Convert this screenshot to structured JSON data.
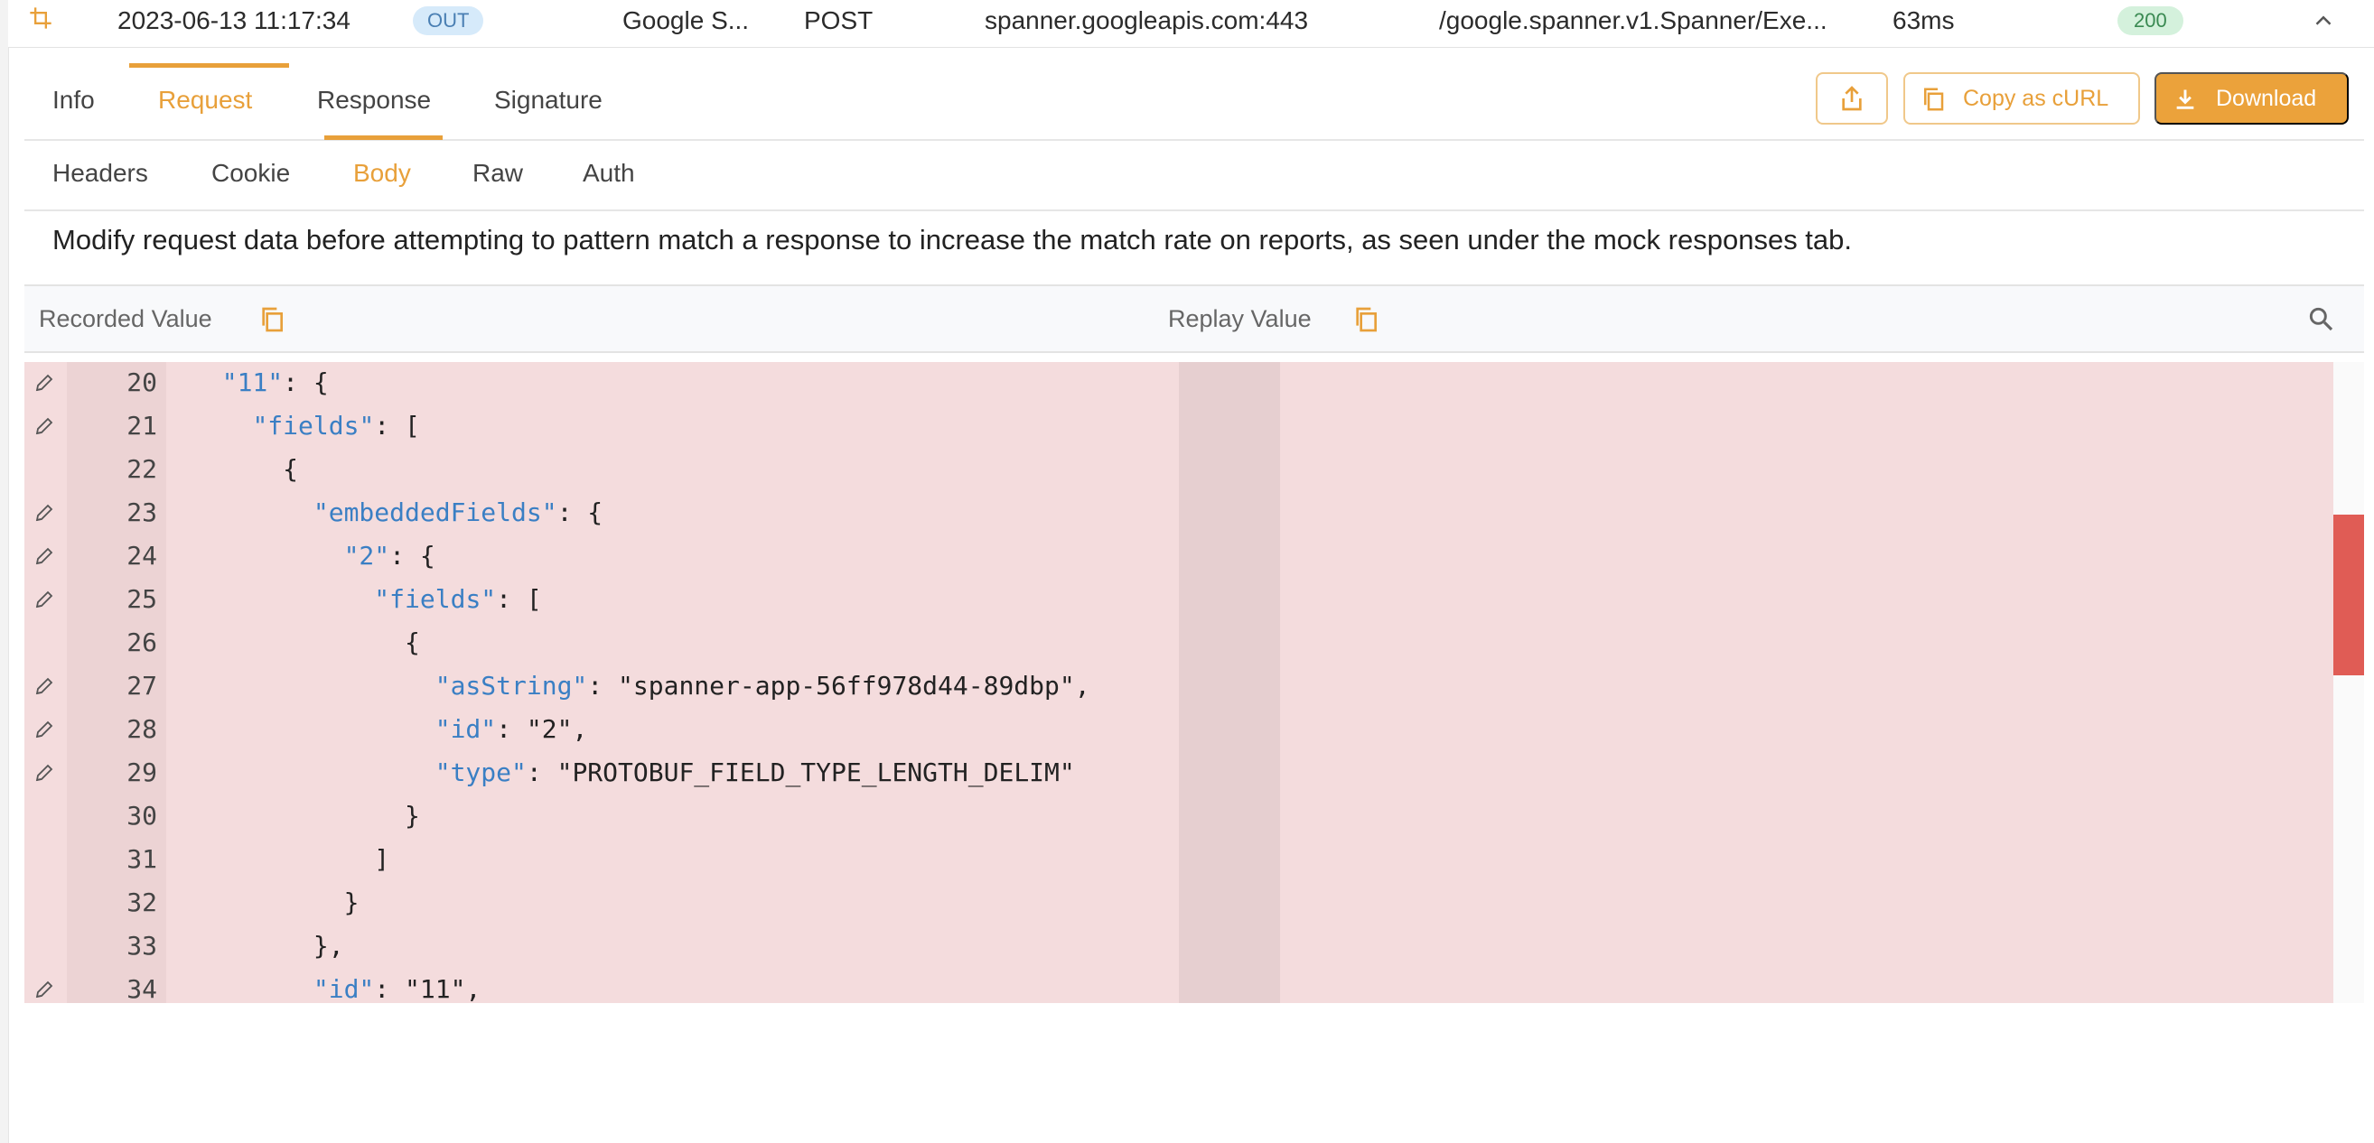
{
  "row": {
    "timestamp": "2023-06-13 11:17:34",
    "direction": "OUT",
    "service": "Google S...",
    "method": "POST",
    "host": "spanner.googleapis.com:443",
    "path": "/google.spanner.v1.Spanner/Exe...",
    "latency": "63ms",
    "status": "200"
  },
  "tabs": [
    "Info",
    "Request",
    "Response",
    "Signature"
  ],
  "active_tab": "Request",
  "actions": {
    "copy_curl": "Copy as cURL",
    "download": "Download"
  },
  "subtabs": [
    "Headers",
    "Cookie",
    "Body",
    "Raw",
    "Auth"
  ],
  "active_subtab": "Body",
  "info_text": "Modify request data before attempting to pattern match a response to increase the match rate on reports, as seen under the mock responses tab.",
  "diff": {
    "recorded_label": "Recorded Value",
    "replay_label": "Replay Value"
  },
  "code_lines": [
    {
      "n": "20",
      "indent": "  ",
      "key": "\"11\"",
      "rest": ": {",
      "edit": true
    },
    {
      "n": "21",
      "indent": "    ",
      "key": "\"fields\"",
      "rest": ": [",
      "edit": true
    },
    {
      "n": "22",
      "indent": "      ",
      "key": "",
      "rest": "{",
      "edit": false
    },
    {
      "n": "23",
      "indent": "        ",
      "key": "\"embeddedFields\"",
      "rest": ": {",
      "edit": true
    },
    {
      "n": "24",
      "indent": "          ",
      "key": "\"2\"",
      "rest": ": {",
      "edit": true
    },
    {
      "n": "25",
      "indent": "            ",
      "key": "\"fields\"",
      "rest": ": [",
      "edit": true
    },
    {
      "n": "26",
      "indent": "              ",
      "key": "",
      "rest": "{",
      "edit": false
    },
    {
      "n": "27",
      "indent": "                ",
      "key": "\"asString\"",
      "rest": ": \"spanner-app-56ff978d44-89dbp\",",
      "edit": true
    },
    {
      "n": "28",
      "indent": "                ",
      "key": "\"id\"",
      "rest": ": \"2\",",
      "edit": true
    },
    {
      "n": "29",
      "indent": "                ",
      "key": "\"type\"",
      "rest": ": \"PROTOBUF_FIELD_TYPE_LENGTH_DELIM\"",
      "edit": true
    },
    {
      "n": "30",
      "indent": "              ",
      "key": "",
      "rest": "}",
      "edit": false
    },
    {
      "n": "31",
      "indent": "            ",
      "key": "",
      "rest": "]",
      "edit": false
    },
    {
      "n": "32",
      "indent": "          ",
      "key": "",
      "rest": "}",
      "edit": false
    },
    {
      "n": "33",
      "indent": "        ",
      "key": "",
      "rest": "},",
      "edit": false
    },
    {
      "n": "34",
      "indent": "        ",
      "key": "\"id\"",
      "rest": ": \"11\",",
      "edit": true
    }
  ],
  "colors": {
    "accent": "#e8a03a",
    "diff_removed_bg": "#f4dcdd",
    "json_key": "#3a7fc4",
    "scroll_marker": "#e05c55"
  }
}
